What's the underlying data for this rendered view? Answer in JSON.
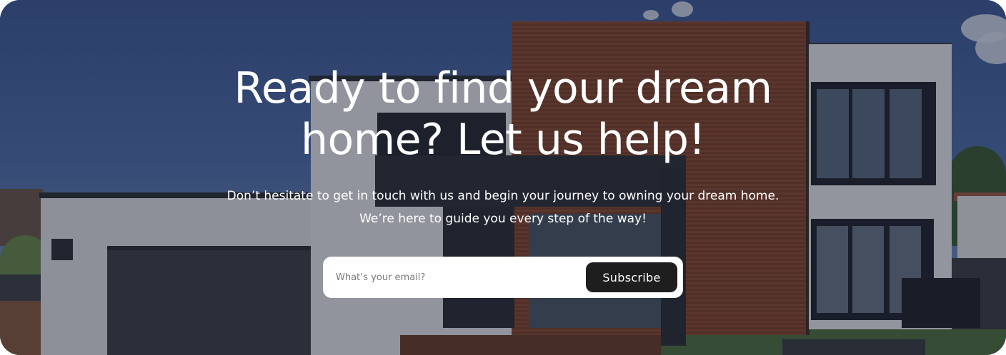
{
  "hero": {
    "headline_line1": "Ready to find your dream",
    "headline_line2": "home? Let us help!",
    "subtext_line1": "Don’t hesitate to get in touch with us and begin your journey to owning your dream home.",
    "subtext_line2": "We’re here to guide you every step of the way!",
    "background_image": "modern-house-photo"
  },
  "subscribe_form": {
    "email_placeholder": "What’s your email?",
    "email_value": "",
    "button_label": "Subscribe"
  },
  "colors": {
    "button_bg": "#1e1e1f",
    "text_primary": "#ffffff",
    "form_bg": "#ffffff"
  }
}
